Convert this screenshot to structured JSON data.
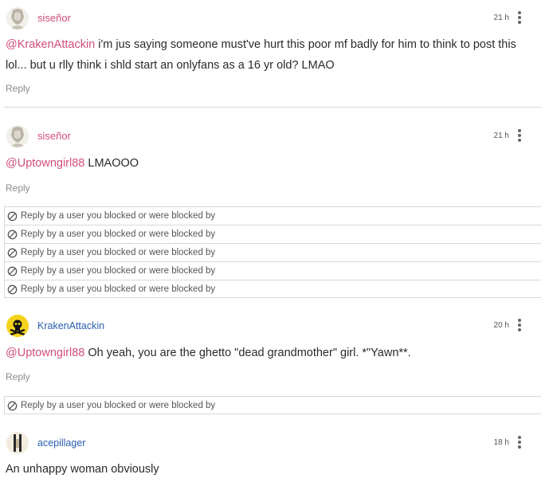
{
  "comments": [
    {
      "username": "siseñor",
      "username_color": "#d24d7a",
      "timestamp": "21 h",
      "mention": "@KrakenAttackin",
      "text": " i'm jus saying someone must've hurt this poor mf badly for him to think to post this lol... but u rlly think i shld start an onlyfans as a 16 yr old? LMAO",
      "reply_label": "Reply"
    },
    {
      "username": "siseñor",
      "username_color": "#d24d7a",
      "timestamp": "21 h",
      "mention": "@Uptowngirl88",
      "text": " LMAOOO",
      "reply_label": "Reply"
    },
    {
      "username": "KrakenAttackin",
      "username_color": "#2a5db0",
      "timestamp": "20 h",
      "mention": "@Uptowngirl88",
      "text": " Oh yeah, you are the ghetto \"dead grandmother\" girl. *\"Yawn**.",
      "reply_label": "Reply"
    },
    {
      "username": "acepillager",
      "username_color": "#2a5db0",
      "timestamp": "18 h",
      "text": "An unhappy woman obviously"
    }
  ],
  "blocked_notice": "Reply by a user you blocked or were blocked by",
  "icons": {
    "kebab": "more-vertical-icon",
    "blocked": "no-entry-icon"
  },
  "colors": {
    "mention": "#d24d7a",
    "pink_user": "#d24d7a",
    "blue_user": "#2a5db0"
  }
}
